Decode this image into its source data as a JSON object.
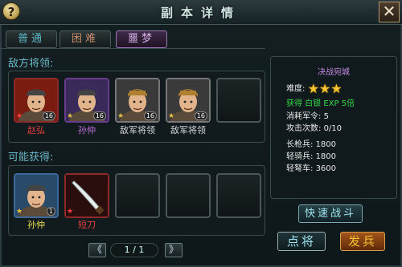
{
  "header": {
    "title": "副本详情",
    "help_label": "?",
    "close_label": "✕"
  },
  "tabs": [
    {
      "label": "普通",
      "state": "normal"
    },
    {
      "label": "困难",
      "state": "normal"
    },
    {
      "label": "噩梦",
      "state": "selected"
    }
  ],
  "enemy_section": {
    "label": "敌方将领:",
    "slots": [
      {
        "name": "赵弘",
        "level": "16",
        "frame": "red",
        "name_color": "#e04040",
        "portrait": "general-portrait-icon"
      },
      {
        "name": "孙仲",
        "level": "16",
        "frame": "purple",
        "name_color": "#c070e0",
        "portrait": "general-portrait-icon"
      },
      {
        "name": "敌军将领",
        "level": "16",
        "frame": "gray",
        "name_color": "#d8d8d8",
        "portrait": "soldier-portrait-icon"
      },
      {
        "name": "敌军将领",
        "level": "16",
        "frame": "gray",
        "name_color": "#d8d8d8",
        "portrait": "soldier-portrait-icon"
      },
      {
        "name": "",
        "level": "",
        "frame": "empty",
        "name_color": "#d8d8d8",
        "portrait": ""
      }
    ]
  },
  "reward_section": {
    "label": "可能获得:",
    "slots": [
      {
        "name": "孙仲",
        "level": "1",
        "frame": "blue",
        "name_color": "#e8e050",
        "portrait": "general-portrait-icon"
      },
      {
        "name": "短刀",
        "level": "",
        "frame": "red",
        "name_color": "#e04040",
        "portrait": "knife-icon"
      },
      {
        "name": "",
        "frame": "empty"
      },
      {
        "name": "",
        "frame": "empty"
      },
      {
        "name": "",
        "frame": "empty"
      }
    ],
    "pager": {
      "text": "1 / 1",
      "prev_label": "《",
      "next_label": "》"
    }
  },
  "info_panel": {
    "stage_name": "决战宛城",
    "difficulty_label": "难度:",
    "difficulty_stars": 3,
    "reward_text": "获得 白银 EXP 5倍",
    "cost_label": "消耗军令:",
    "cost_value": "5",
    "attempts_label": "攻击次数:",
    "attempts_value": "0/10",
    "troops": [
      {
        "label": "长枪兵:",
        "value": "1800"
      },
      {
        "label": "轻骑兵:",
        "value": "1800"
      },
      {
        "label": "轻弩车:",
        "value": "3600"
      }
    ]
  },
  "actions": {
    "fast_battle": "快速战斗",
    "choose_general": "点将",
    "send_troops": "发兵"
  },
  "colors": {
    "accent_cyan": "#6bb6c4",
    "gold": "#f2c232",
    "purple": "#c58ae6"
  }
}
